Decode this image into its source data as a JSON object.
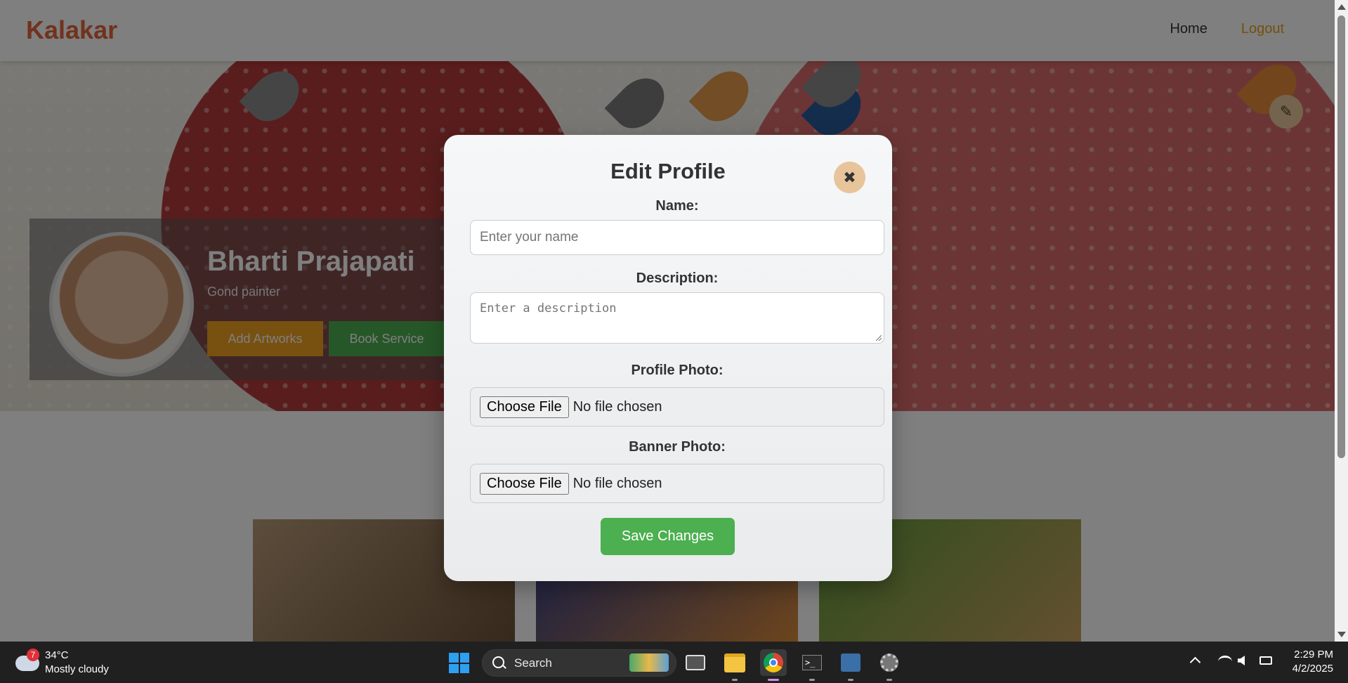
{
  "app": {
    "brand": "Kalakar",
    "nav": {
      "home": "Home",
      "logout": "Logout"
    }
  },
  "profile": {
    "name": "Bharti Prajapati",
    "subtitle": "Gond painter",
    "add_button": "Add Artworks",
    "book_button": "Book Service"
  },
  "modal": {
    "title": "Edit Profile",
    "close_icon": "close-icon",
    "name_label": "Name:",
    "name_placeholder": "Enter your name",
    "name_value": "",
    "description_label": "Description:",
    "description_placeholder": "Enter a description",
    "description_value": "",
    "profile_photo_label": "Profile Photo:",
    "banner_photo_label": "Banner Photo:",
    "choose_file": "Choose File",
    "no_file": "No file chosen",
    "save_button": "Save Changes"
  },
  "taskbar": {
    "weather_badge": "7",
    "temperature": "34°C",
    "weather": "Mostly cloudy",
    "search_label": "Search",
    "time": "2:29 PM",
    "date": "4/2/2025"
  },
  "colors": {
    "brand": "#e2653a",
    "logout": "#e6a020",
    "save": "#4caf50",
    "close_button": "#e8c49a",
    "add_button": "#f0a020"
  }
}
